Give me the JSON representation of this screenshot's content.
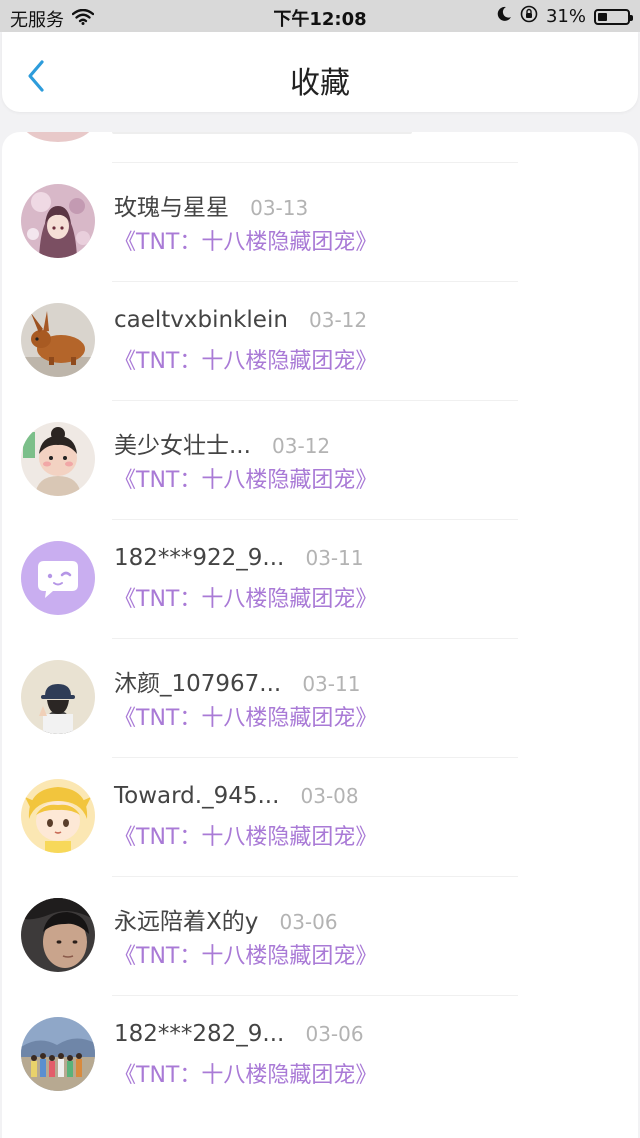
{
  "status_bar": {
    "carrier": "无服务",
    "time": "下午12:08",
    "battery_percent": "31%",
    "battery_level": 0.31
  },
  "header": {
    "title": "收藏"
  },
  "colors": {
    "accent_blue": "#2d9cdb",
    "book_purple": "#a97ad6"
  },
  "items": [
    {
      "name": "玫瑰与星星",
      "date": "03-13",
      "book": "《TNT：十八楼隐藏团宠》",
      "avatar": "anime-girl-avatar"
    },
    {
      "name": "caeltvxbinklein",
      "date": "03-12",
      "book": "《TNT：十八楼隐藏团宠》",
      "avatar": "rabbit-figurine-avatar"
    },
    {
      "name": "美少女壮士...",
      "date": "03-12",
      "book": "《TNT：十八楼隐藏团宠》",
      "avatar": "child-photo-avatar"
    },
    {
      "name": "182***922_9...",
      "date": "03-11",
      "book": "《TNT：十八楼隐藏团宠》",
      "avatar": "default-chat-avatar"
    },
    {
      "name": "沐颜_107967...",
      "date": "03-11",
      "book": "《TNT：十八楼隐藏团宠》",
      "avatar": "hat-girl-avatar"
    },
    {
      "name": "Toward._945...",
      "date": "03-08",
      "book": "《TNT：十八楼隐藏团宠》",
      "avatar": "cartoon-boy-avatar"
    },
    {
      "name": "永远陪着X的y",
      "date": "03-06",
      "book": "《TNT：十八楼隐藏团宠》",
      "avatar": "person-photo-avatar"
    },
    {
      "name": "182***282_9...",
      "date": "03-06",
      "book": "《TNT：十八楼隐藏团宠》",
      "avatar": "group-photo-avatar"
    }
  ]
}
